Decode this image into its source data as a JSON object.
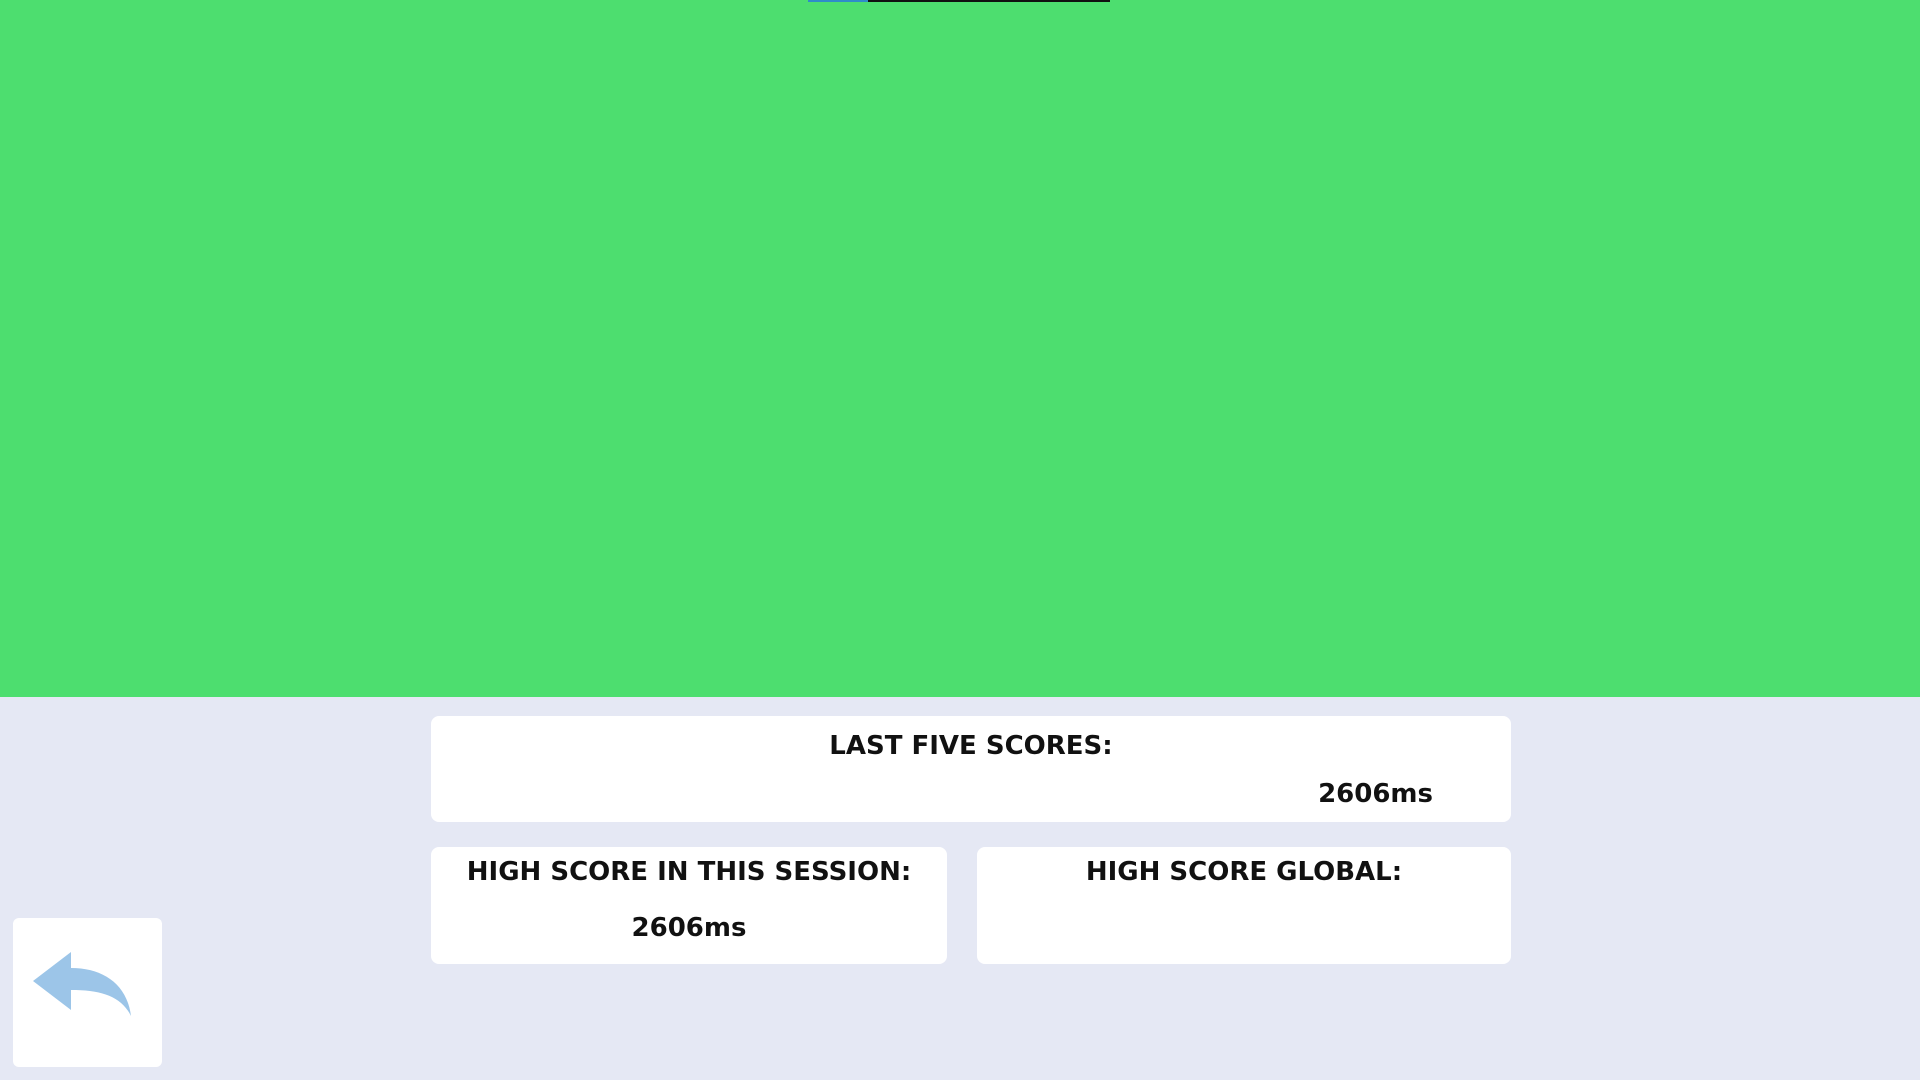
{
  "game": {
    "area_color": "#4dde6f",
    "progress": 0.2
  },
  "last_five": {
    "title": "LAST FIVE SCORES:",
    "scores": [
      "2606ms"
    ]
  },
  "session_high": {
    "title": "HIGH SCORE IN THIS SESSION:",
    "value": "2606ms"
  },
  "global_high": {
    "title": "HIGH SCORE GLOBAL:",
    "value": ""
  },
  "back_button": {
    "icon": "back-arrow-icon",
    "color": "#9cc5e8"
  }
}
